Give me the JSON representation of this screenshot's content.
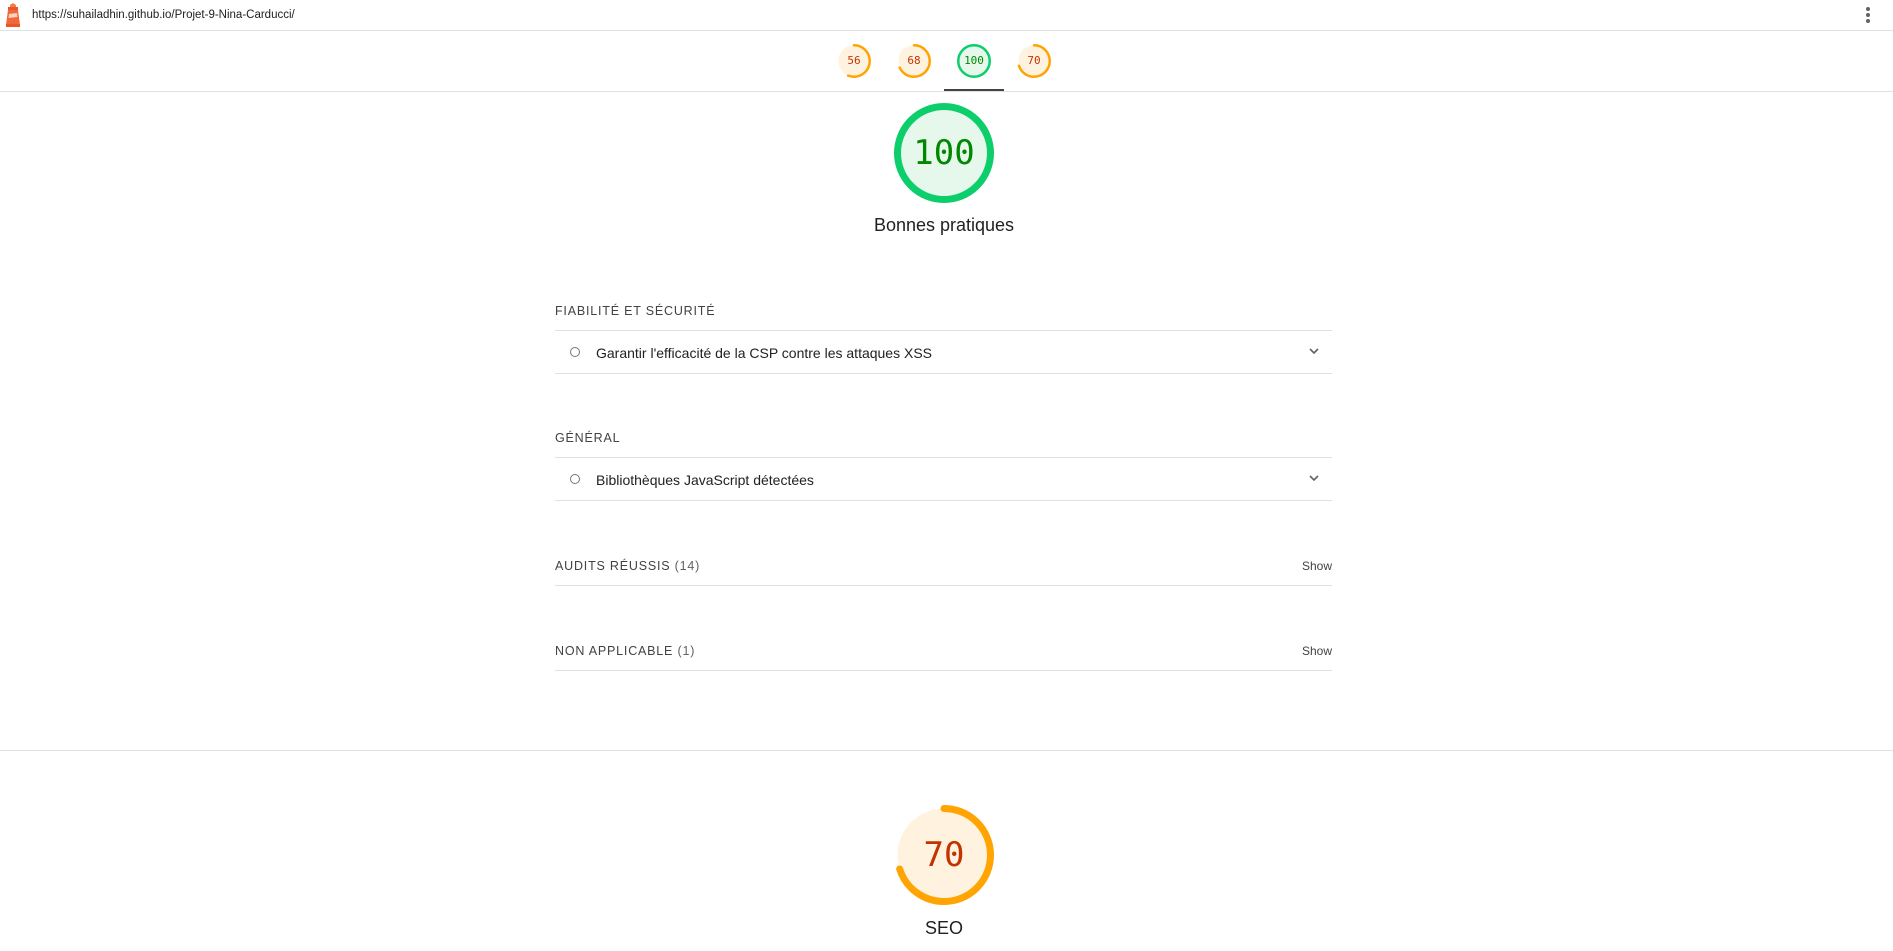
{
  "browser": {
    "url": "https://suhailadhin.github.io/Projet-9-Nina-Carducci/"
  },
  "colors": {
    "pass": "#0cce6b",
    "pass_text": "#008800",
    "pass_bg": "#e6f7ec",
    "average": "#ffa400",
    "average_text": "#c33300",
    "average_bg": "#fff3e0"
  },
  "tabs": [
    {
      "score": "56",
      "value": 56,
      "rating": "average"
    },
    {
      "score": "68",
      "value": 68,
      "rating": "average"
    },
    {
      "score": "100",
      "value": 100,
      "rating": "pass",
      "selected": true
    },
    {
      "score": "70",
      "value": 70,
      "rating": "average"
    }
  ],
  "best_practices": {
    "score": "100",
    "value": 100,
    "title": "Bonnes pratiques",
    "groups": [
      {
        "header": "FIABILITÉ ET SÉCURITÉ",
        "audits": [
          {
            "label": "Garantir l'efficacité de la CSP contre les attaques XSS",
            "icon": "informative-circle-icon"
          }
        ]
      },
      {
        "header": "GÉNÉRAL",
        "audits": [
          {
            "label": "Bibliothèques JavaScript détectées",
            "icon": "informative-circle-icon"
          }
        ]
      }
    ],
    "passed": {
      "label": "AUDITS RÉUSSIS",
      "count": "(14)",
      "action": "Show"
    },
    "not_applicable": {
      "label": "NON APPLICABLE",
      "count": "(1)",
      "action": "Show"
    }
  },
  "seo": {
    "score": "70",
    "value": 70,
    "title": "SEO"
  }
}
